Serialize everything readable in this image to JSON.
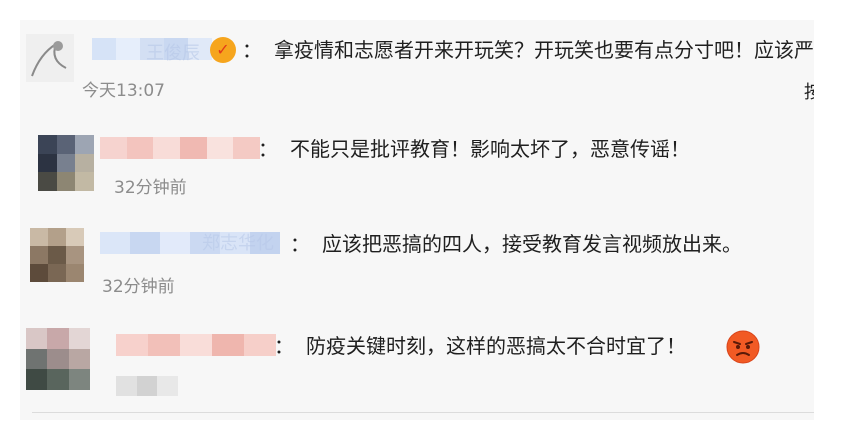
{
  "comments": [
    {
      "text": "拿疫情和志愿者开来开玩笑？开玩笑也要有点分寸吧！应该严惩",
      "time": "今天13:07",
      "name_partial": "王俊辰",
      "verified_icon": "verified-v-badge",
      "overflow_char": "按",
      "accent_color": "#f6a51d"
    },
    {
      "text": "不能只是批评教育！影响太坏了，恶意传谣！",
      "time": "32分钟前"
    },
    {
      "text": "应该把恶搞的四人，接受教育发言视频放出来。",
      "time": "32分钟前",
      "name_partial": "郑志华化"
    },
    {
      "text": "防疫关键时刻，这样的恶搞太不合时宜了！",
      "time": "",
      "emoji": "angry-face-emoji"
    }
  ],
  "separator": "："
}
